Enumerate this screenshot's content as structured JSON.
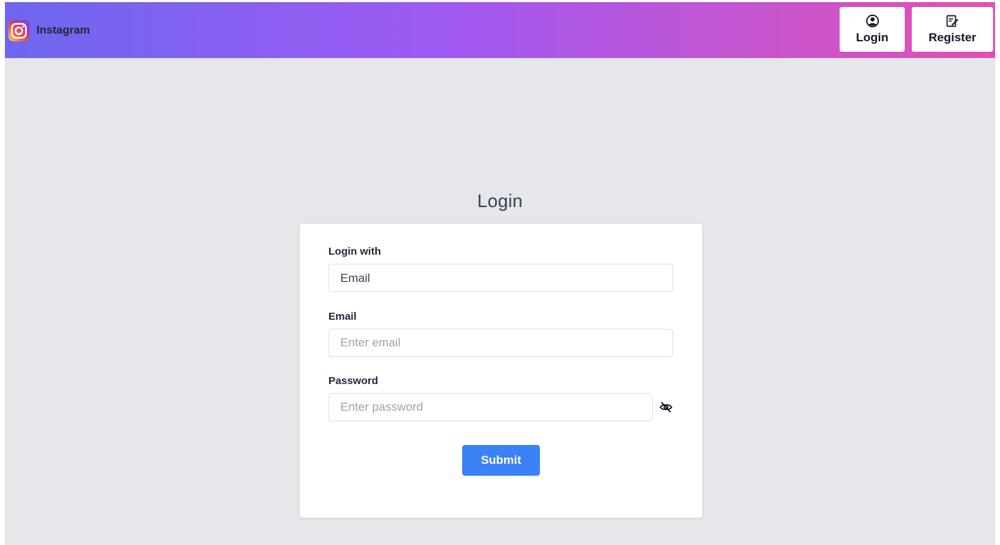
{
  "navbar": {
    "brand_name": "Instagram",
    "brand_icon": "instagram-logo",
    "login_label": "Login",
    "login_icon": "user-circle-icon",
    "register_label": "Register",
    "register_icon": "edit-note-icon"
  },
  "page": {
    "title": "Login"
  },
  "form": {
    "login_with_label": "Login with",
    "login_with_value": "Email",
    "login_with_options": [
      "Email"
    ],
    "email_label": "Email",
    "email_placeholder": "Enter email",
    "email_value": "",
    "password_label": "Password",
    "password_placeholder": "Enter password",
    "password_value": "",
    "password_toggle_icon": "eye-slash-icon",
    "submit_label": "Submit"
  },
  "colors": {
    "navbar_gradient": [
      "#6d67f0",
      "#9f59f2",
      "#bf56d6",
      "#e24fb2"
    ],
    "background": "#e5e7eb",
    "primary_button": "#3b82f6"
  }
}
